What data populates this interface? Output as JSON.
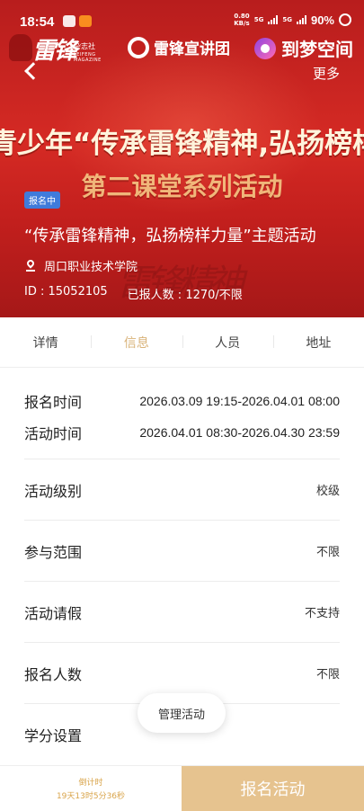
{
  "status_bar": {
    "time": "18:54",
    "speed_value": "0.80",
    "speed_unit": "KB/s",
    "network_1": "5G",
    "network_2": "5G",
    "battery": "90%"
  },
  "logos": {
    "leifeng_brush": "雷锋",
    "leifeng_sub": "杂志社",
    "leifeng_en": "LEIFENG MAGAZINE",
    "team": "雷锋宣讲团",
    "dream": "到梦空间"
  },
  "nav": {
    "back_icon": "chevron-left-icon",
    "more_label": "更多"
  },
  "banner": {
    "headline": "青少年“传承雷锋精神,弘扬榜样",
    "subline": "第二课堂系列活动",
    "script_deco": "雷锋精神"
  },
  "activity": {
    "status_badge": "报名中",
    "title": "“传承雷锋精神，弘扬榜样力量”主题活动",
    "location": "周口职业技术学院",
    "id_text": "ID : 15052105",
    "signup_count": "已报人数 : 1270/不限"
  },
  "tabs": [
    {
      "label": "详情",
      "active": false
    },
    {
      "label": "信息",
      "active": true
    },
    {
      "label": "人员",
      "active": false
    },
    {
      "label": "地址",
      "active": false
    }
  ],
  "info": {
    "signup_time": {
      "label": "报名时间",
      "value": "2026.03.09 19:15-2026.04.01 08:00"
    },
    "activity_time": {
      "label": "活动时间",
      "value": "2026.04.01 08:30-2026.04.30 23:59"
    },
    "rows": [
      {
        "label": "活动级别",
        "value": "校级"
      },
      {
        "label": "参与范围",
        "value": "不限"
      },
      {
        "label": "活动请假",
        "value": "不支持"
      },
      {
        "label": "报名人数",
        "value": "不限"
      },
      {
        "label": "学分设置",
        "value": ""
      }
    ]
  },
  "manage_button": "管理活动",
  "bottom": {
    "countdown_label": "倒计时",
    "countdown_value": "19天13时5分36秒",
    "signup_button": "报名活动"
  },
  "colors": {
    "banner_red": "#c21f1d",
    "accent_gold": "#d9b37a",
    "signup_button": "#e6c38f",
    "status_badge": "#3f7bdb"
  }
}
